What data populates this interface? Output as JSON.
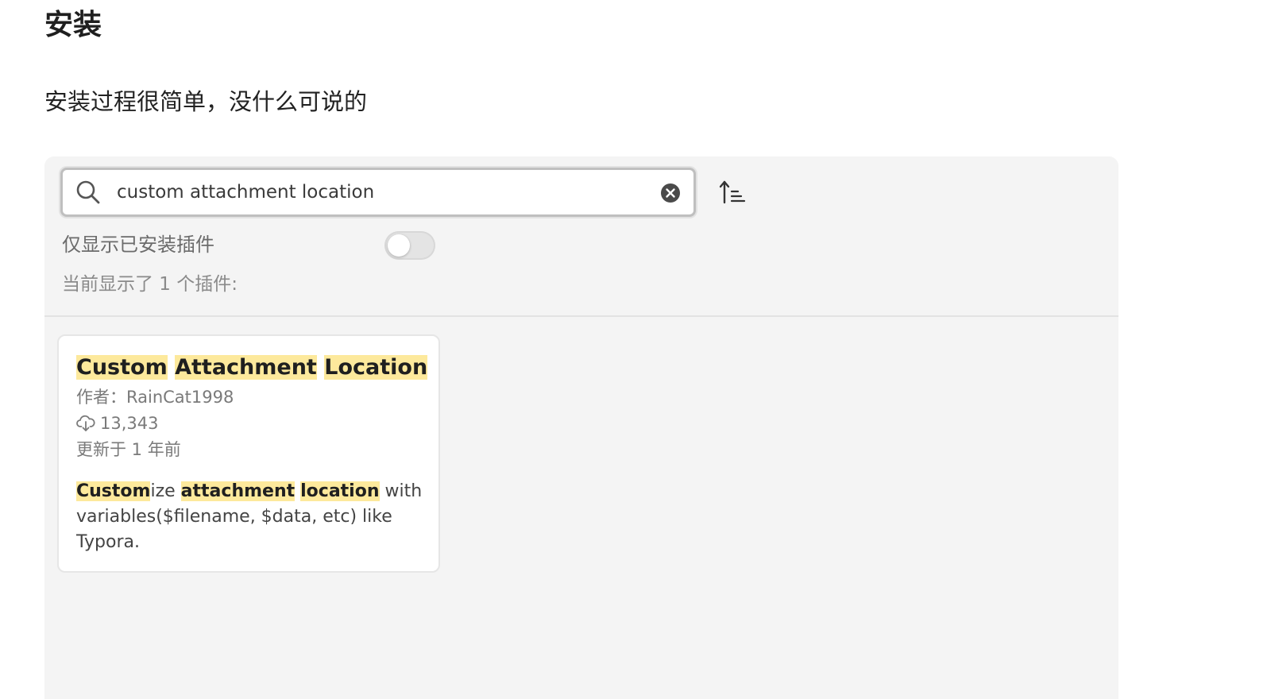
{
  "page": {
    "heading": "安装",
    "paragraph": "安装过程很简单，没什么可说的"
  },
  "search": {
    "value": "custom attachment location",
    "icon": "search-icon",
    "clear_icon": "clear-icon"
  },
  "sort": {
    "icon": "sort-ascending-icon"
  },
  "filter": {
    "installed_only_label": "仅显示已安装插件",
    "installed_only_enabled": false
  },
  "results": {
    "count_label": "当前显示了 1 个插件:"
  },
  "plugin": {
    "title_words": [
      "Custom",
      "Attachment",
      "Location"
    ],
    "author_line": "作者：RainCat1998",
    "downloads": "13,343",
    "updated": "更新于 1 年前",
    "description": {
      "hl_1": "Custom",
      "rest_1": "ize ",
      "hl_2": "attachment",
      "space": " ",
      "hl_3": "location",
      "rest_2": " with variables($filename, $data, etc) like Typora."
    }
  },
  "colors": {
    "highlight": "#fde99c",
    "panel_bg": "#f4f4f4"
  }
}
